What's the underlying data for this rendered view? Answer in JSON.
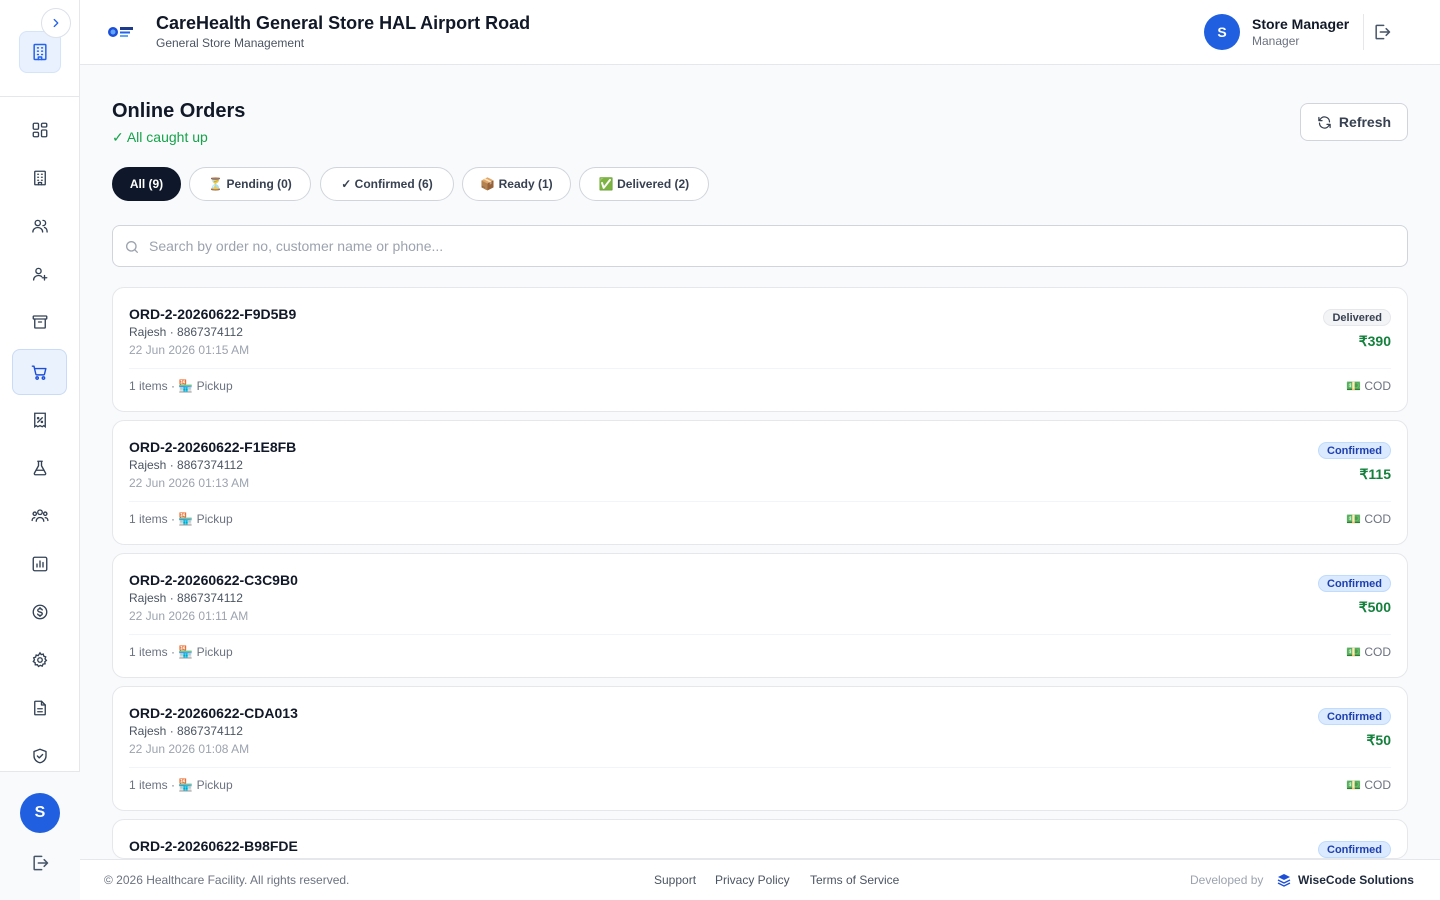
{
  "header": {
    "title": "CareHealth General Store HAL Airport Road",
    "subtitle": "General Store Management",
    "user_initial": "S",
    "user_name": "Store Manager",
    "user_role": "Manager"
  },
  "sidebar": {
    "avatar_initial": "S",
    "items": [
      {
        "icon": "dashboard-icon"
      },
      {
        "icon": "building-icon"
      },
      {
        "icon": "users-icon"
      },
      {
        "icon": "user-plus-icon"
      },
      {
        "icon": "archive-icon"
      },
      {
        "icon": "cart-icon",
        "active": true
      },
      {
        "icon": "receipt-percent-icon"
      },
      {
        "icon": "flask-icon"
      },
      {
        "icon": "team-icon"
      },
      {
        "icon": "report-icon"
      },
      {
        "icon": "dollar-icon"
      },
      {
        "icon": "settings-icon"
      },
      {
        "icon": "document-icon"
      },
      {
        "icon": "shield-check-icon"
      }
    ]
  },
  "main": {
    "title": "Online Orders",
    "status": "✓ All caught up",
    "refresh_label": "Refresh",
    "search_placeholder": "Search by order no, customer name or phone...",
    "filters": [
      {
        "label": "All (9)",
        "active": true
      },
      {
        "label": "⏳ Pending (0)"
      },
      {
        "label": "✓ Confirmed (6)"
      },
      {
        "label": "📦 Ready (1)"
      },
      {
        "label": "✅ Delivered (2)"
      }
    ],
    "orders": [
      {
        "order_no": "ORD-2-20260622-F9D5B9",
        "customer": "Rajesh · 8867374112",
        "date": "22 Jun 2026 01:15 AM",
        "status": "Delivered",
        "amount": "₹390",
        "meta": "1 items · 🏪 Pickup",
        "payment": "💵 COD"
      },
      {
        "order_no": "ORD-2-20260622-F1E8FB",
        "customer": "Rajesh · 8867374112",
        "date": "22 Jun 2026 01:13 AM",
        "status": "Confirmed",
        "amount": "₹115",
        "meta": "1 items · 🏪 Pickup",
        "payment": "💵 COD"
      },
      {
        "order_no": "ORD-2-20260622-C3C9B0",
        "customer": "Rajesh · 8867374112",
        "date": "22 Jun 2026 01:11 AM",
        "status": "Confirmed",
        "amount": "₹500",
        "meta": "1 items · 🏪 Pickup",
        "payment": "💵 COD"
      },
      {
        "order_no": "ORD-2-20260622-CDA013",
        "customer": "Rajesh · 8867374112",
        "date": "22 Jun 2026 01:08 AM",
        "status": "Confirmed",
        "amount": "₹50",
        "meta": "1 items · 🏪 Pickup",
        "payment": "💵 COD"
      },
      {
        "order_no": "ORD-2-20260622-B98FDE",
        "customer": "",
        "date": "",
        "status": "Confirmed",
        "amount": "",
        "meta": "",
        "payment": ""
      }
    ]
  },
  "footer": {
    "copyright": "© 2026 Healthcare Facility. All rights reserved.",
    "links": [
      "Support",
      "Privacy Policy",
      "Terms of Service"
    ],
    "developed_by": "Developed by",
    "brand": "WiseCode Solutions"
  },
  "colors": {
    "primary": "#1f5fe0",
    "dark": "#0f172a",
    "success": "#16a34a",
    "amount": "#15803d"
  }
}
